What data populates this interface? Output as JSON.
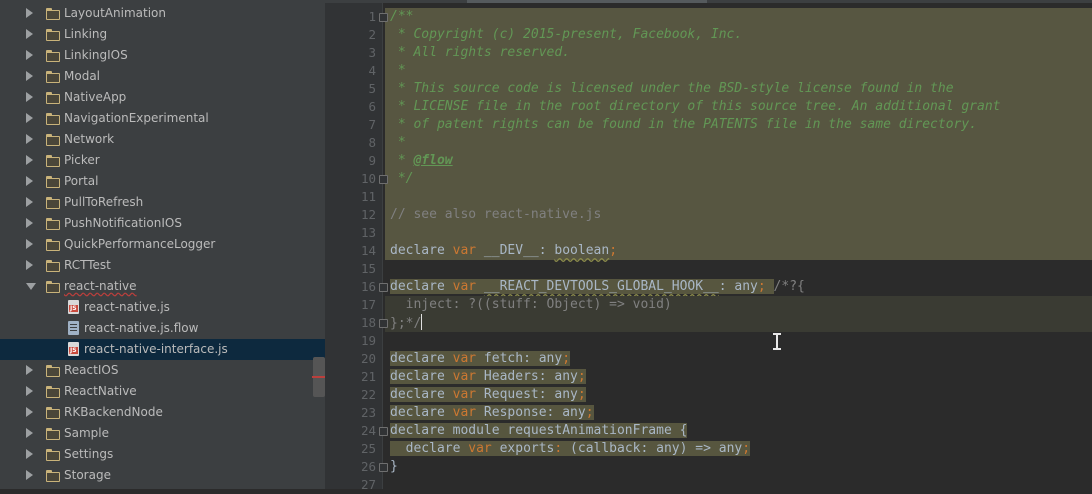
{
  "tree": {
    "items": [
      {
        "label": "LayoutAnimation",
        "kind": "folder"
      },
      {
        "label": "Linking",
        "kind": "folder"
      },
      {
        "label": "LinkingIOS",
        "kind": "folder"
      },
      {
        "label": "Modal",
        "kind": "folder"
      },
      {
        "label": "NativeApp",
        "kind": "folder"
      },
      {
        "label": "NavigationExperimental",
        "kind": "folder"
      },
      {
        "label": "Network",
        "kind": "folder"
      },
      {
        "label": "Picker",
        "kind": "folder"
      },
      {
        "label": "Portal",
        "kind": "folder"
      },
      {
        "label": "PullToRefresh",
        "kind": "folder"
      },
      {
        "label": "PushNotificationIOS",
        "kind": "folder"
      },
      {
        "label": "QuickPerformanceLogger",
        "kind": "folder"
      },
      {
        "label": "RCTTest",
        "kind": "folder"
      },
      {
        "label": "react-native",
        "kind": "folder-open",
        "error": true
      },
      {
        "label": "react-native.js",
        "kind": "js-file"
      },
      {
        "label": "react-native.js.flow",
        "kind": "flow-file"
      },
      {
        "label": "react-native-interface.js",
        "kind": "js-file",
        "selected": true
      },
      {
        "label": "ReactIOS",
        "kind": "folder"
      },
      {
        "label": "ReactNative",
        "kind": "folder"
      },
      {
        "label": "RKBackendNode",
        "kind": "folder"
      },
      {
        "label": "Sample",
        "kind": "folder"
      },
      {
        "label": "Settings",
        "kind": "folder"
      },
      {
        "label": "Storage",
        "kind": "folder"
      }
    ]
  },
  "editor": {
    "lines": [
      {
        "n": "1",
        "bg": "doc",
        "fold": true,
        "segs": [
          [
            "doc",
            "/**"
          ]
        ]
      },
      {
        "n": "2",
        "bg": "doc",
        "segs": [
          [
            "doc",
            " * Copyright (c) 2015-present, Facebook, Inc."
          ]
        ]
      },
      {
        "n": "3",
        "bg": "doc",
        "segs": [
          [
            "doc",
            " * All rights reserved."
          ]
        ]
      },
      {
        "n": "4",
        "bg": "doc",
        "segs": [
          [
            "doc",
            " *"
          ]
        ]
      },
      {
        "n": "5",
        "bg": "doc",
        "segs": [
          [
            "doc",
            " * This source code is licensed under the BSD-style license found in the"
          ]
        ]
      },
      {
        "n": "6",
        "bg": "doc",
        "segs": [
          [
            "doc",
            " * LICENSE file in the root directory of this source tree. An additional grant"
          ]
        ]
      },
      {
        "n": "7",
        "bg": "doc",
        "segs": [
          [
            "doc",
            " * of patent rights can be found in the PATENTS file in the same directory."
          ]
        ]
      },
      {
        "n": "8",
        "bg": "doc",
        "segs": [
          [
            "doc",
            " *"
          ]
        ]
      },
      {
        "n": "9",
        "bg": "doc",
        "segs": [
          [
            "doc",
            " * "
          ],
          [
            "tag",
            "@flow"
          ]
        ]
      },
      {
        "n": "10",
        "bg": "doc",
        "fold": true,
        "segs": [
          [
            "doc",
            " */"
          ]
        ]
      },
      {
        "n": "11",
        "bg": "doc",
        "segs": []
      },
      {
        "n": "12",
        "bg": "doc",
        "segs": [
          [
            "cmt",
            "// see also react-native.js"
          ]
        ]
      },
      {
        "n": "13",
        "bg": "doc",
        "segs": []
      },
      {
        "n": "14",
        "bg": "doc",
        "segs": [
          [
            "pl",
            "declare "
          ],
          [
            "kw",
            "var"
          ],
          [
            "pl",
            " __DEV__: "
          ],
          [
            "wavy",
            "boolean"
          ],
          [
            "kw",
            ";"
          ]
        ]
      },
      {
        "n": "15",
        "bg": "none",
        "segs": []
      },
      {
        "n": "16",
        "bg": "hl",
        "fold": true,
        "segs": [
          [
            "pl",
            "declare "
          ],
          [
            "kw",
            "var"
          ],
          [
            "pl",
            " "
          ],
          [
            "wavy",
            "__REACT_DEVTOOLS_GLOBAL_HOOK__"
          ],
          [
            "pl",
            ": any"
          ],
          [
            "kw",
            ";"
          ],
          [
            "pl",
            " "
          ],
          [
            "cmt",
            "/*?{"
          ]
        ]
      },
      {
        "n": "17",
        "bg": "obj",
        "segs": [
          [
            "cmt",
            "  inject: ?((stuff: Object) => void)"
          ]
        ]
      },
      {
        "n": "18",
        "bg": "obj",
        "fold": true,
        "segs": [
          [
            "cmt",
            "};*/"
          ],
          [
            "caret",
            ""
          ]
        ]
      },
      {
        "n": "19",
        "bg": "none",
        "segs": []
      },
      {
        "n": "20",
        "bg": "hl",
        "segs": [
          [
            "pl",
            "declare "
          ],
          [
            "kw",
            "var"
          ],
          [
            "pl",
            " fetch: any"
          ],
          [
            "kw",
            ";"
          ]
        ]
      },
      {
        "n": "21",
        "bg": "hl",
        "segs": [
          [
            "pl",
            "declare "
          ],
          [
            "kw",
            "var"
          ],
          [
            "pl",
            " Headers: any"
          ],
          [
            "kw",
            ";"
          ]
        ]
      },
      {
        "n": "22",
        "bg": "hl",
        "segs": [
          [
            "pl",
            "declare "
          ],
          [
            "kw",
            "var"
          ],
          [
            "pl",
            " Request: any"
          ],
          [
            "kw",
            ";"
          ]
        ]
      },
      {
        "n": "23",
        "bg": "hl",
        "segs": [
          [
            "pl",
            "declare "
          ],
          [
            "kw",
            "var"
          ],
          [
            "pl",
            " Response: any"
          ],
          [
            "kw",
            ";"
          ]
        ]
      },
      {
        "n": "24",
        "bg": "hl",
        "fold": true,
        "segs": [
          [
            "pl",
            "declare module "
          ],
          [
            "fn",
            "requestAnimationFrame "
          ],
          [
            "pl",
            "{"
          ]
        ]
      },
      {
        "n": "25",
        "bg": "hl",
        "segs": [
          [
            "pl",
            "  declare "
          ],
          [
            "kw",
            "var"
          ],
          [
            "pl",
            " exports"
          ],
          [
            "kw",
            ":"
          ],
          [
            "pl",
            " (callback: any) => any"
          ],
          [
            "kw",
            ";"
          ]
        ]
      },
      {
        "n": "26",
        "bg": "none",
        "fold": true,
        "segs": [
          [
            "pl",
            "}"
          ]
        ]
      },
      {
        "n": "27",
        "bg": "none",
        "segs": []
      }
    ]
  },
  "colors": {
    "tree_bg": "#3c3f41",
    "editor_bg": "#2b2b2b",
    "selection": "#0d293e",
    "doc_comment": "#629755",
    "keyword": "#cc7832",
    "comment": "#808080",
    "text": "#a9b7c6"
  }
}
